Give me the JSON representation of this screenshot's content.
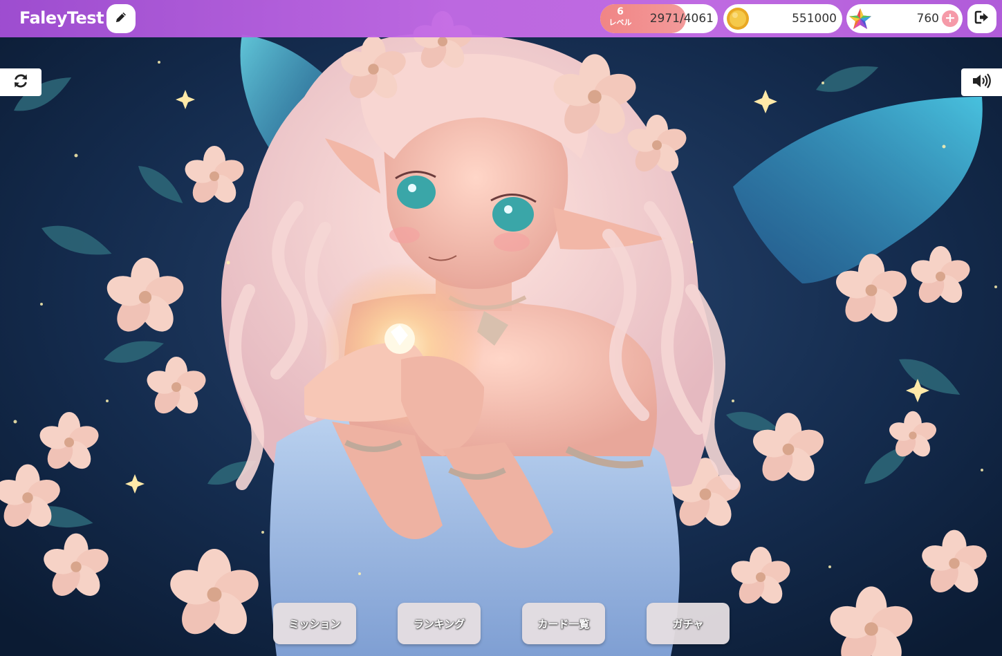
{
  "header": {
    "username": "FaleyTest",
    "level": {
      "value": "6",
      "label": "レベル",
      "exp_text": "2971/4061",
      "progress_fraction": 0.731
    },
    "coins": "551000",
    "stars": "760",
    "plus_label": "+"
  },
  "menu": {
    "items": [
      {
        "label": "ミッション"
      },
      {
        "label": "ランキング"
      },
      {
        "label": "カード一覧"
      },
      {
        "label": "ガチャ"
      }
    ]
  },
  "icons": {
    "edit": "pencil-icon",
    "coin": "gold-coin-icon",
    "star": "rainbow-star-icon",
    "logout": "sign-out-icon",
    "refresh": "refresh-icon",
    "sound": "speaker-icon"
  },
  "colors": {
    "header_bg": "#c46be6",
    "level_fill": "#f08585",
    "plus": "#f59aa8",
    "menu_button": "#e6dee2"
  }
}
